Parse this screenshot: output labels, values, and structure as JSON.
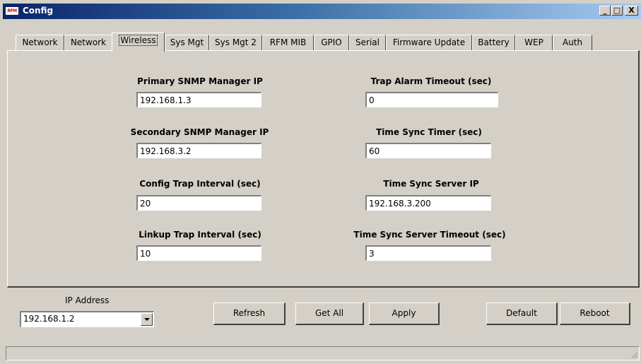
{
  "window": {
    "title": "Config",
    "icon_text": "RFM"
  },
  "titlebar_buttons": {
    "minimize": "_",
    "maximize": "□",
    "close": "X"
  },
  "tabs": [
    {
      "label": "Network"
    },
    {
      "label": "Network"
    },
    {
      "label": "Wireless",
      "active": true
    },
    {
      "label": "Sys Mgt"
    },
    {
      "label": "Sys Mgt 2"
    },
    {
      "label": "RFM MIB"
    },
    {
      "label": "GPIO"
    },
    {
      "label": "Serial"
    },
    {
      "label": "Firmware Update"
    },
    {
      "label": "Battery"
    },
    {
      "label": "WEP"
    },
    {
      "label": "Auth"
    }
  ],
  "fields": {
    "primary_snmp_ip": {
      "label": "Primary SNMP Manager IP",
      "value": "192.168.1.3"
    },
    "secondary_snmp_ip": {
      "label": "Secondary SNMP Manager IP",
      "value": "192.168.3.2"
    },
    "config_trap_interval": {
      "label": "Config Trap Interval (sec)",
      "value": "20"
    },
    "linkup_trap_interval": {
      "label": "Linkup Trap Interval (sec)",
      "value": "10"
    },
    "trap_alarm_timeout": {
      "label": "Trap Alarm Timeout (sec)",
      "value": "0"
    },
    "time_sync_timer": {
      "label": "Time Sync Timer (sec)",
      "value": "60"
    },
    "time_sync_server_ip": {
      "label": "Time Sync Server IP",
      "value": "192.168.3.200"
    },
    "time_sync_server_timeout": {
      "label": "Time Sync Server Timeout (sec)",
      "value": "3"
    }
  },
  "ip_address": {
    "label": "IP Address",
    "value": "192.168.1.2"
  },
  "buttons": {
    "refresh": "Refresh",
    "get_all": "Get All",
    "apply": "Apply",
    "default": "Default",
    "reboot": "Reboot"
  }
}
